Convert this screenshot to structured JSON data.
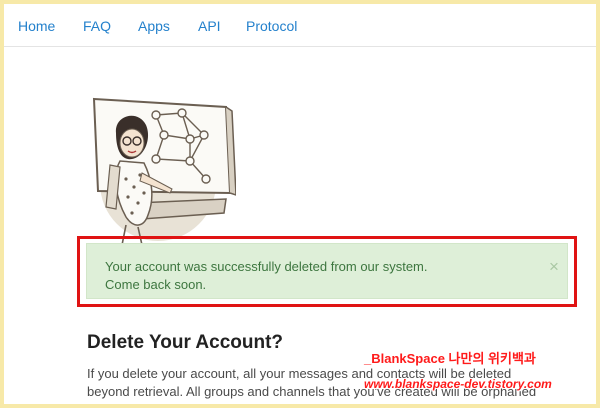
{
  "nav": {
    "items": [
      {
        "label": "Home"
      },
      {
        "label": "FAQ"
      },
      {
        "label": "Apps"
      },
      {
        "label": "API"
      },
      {
        "label": "Protocol"
      }
    ]
  },
  "alert": {
    "line1": "Your account was successfully deleted from our system.",
    "line2": "Come back soon.",
    "close": "×"
  },
  "section": {
    "title": "Delete Your Account?",
    "line1": "If you delete your account, all your messages and contacts will be deleted",
    "line2": "beyond retrieval. All groups and channels that you've created will be orphaned"
  },
  "watermark": {
    "title": "_BlankSpace 나만의 위키백과",
    "url": "www.blankspace-dev.tistory.com"
  },
  "colors": {
    "link": "#2481cc",
    "alert_bg": "#deefd8",
    "alert_text": "#3d763f",
    "highlight": "#e01313",
    "page_border": "#f7e9a8"
  }
}
